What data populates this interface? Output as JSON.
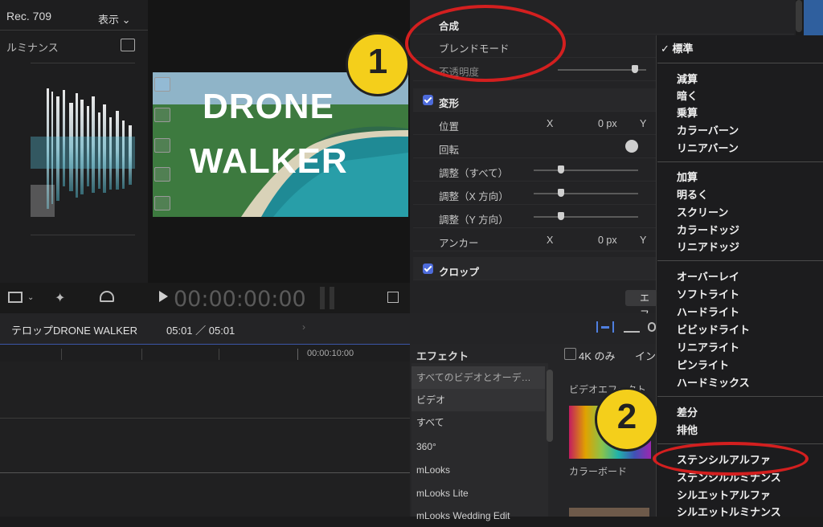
{
  "scope": {
    "colorspace": "Rec. 709",
    "view_menu": "表示 ⌄",
    "mode": "ルミナンス"
  },
  "viewer": {
    "title_line1": "DRONE",
    "title_line2": "WALKER",
    "timecode": "00:00:00:00"
  },
  "inspector": {
    "compositing": "合成",
    "blend_mode": "ブレンドモード",
    "opacity": "不透明度",
    "transform": "変形",
    "position": "位置",
    "rotation": "回転",
    "scale_all": "調整（すべて）",
    "scale_x": "調整（X 方向）",
    "scale_y": "調整（Y 方向）",
    "anchor": "アンカー",
    "crop": "クロップ",
    "x_label": "X",
    "y_label": "Y",
    "pos_x_value": "0 px",
    "anchor_x_value": "0 px",
    "effects_button": "エフ"
  },
  "timeline": {
    "project_name": "テロップDRONE WALKER",
    "duration": "05:01 ／ 05:01",
    "ruler_time": "00:00:10:00"
  },
  "effects": {
    "title": "エフェクト",
    "filter_4k": "4K のみ",
    "filter_suffix": "イン",
    "categories": [
      "すべてのビデオとオーデ…",
      "ビデオ",
      "すべて",
      "360°",
      "mLooks",
      "mLooks Lite",
      "mLooks Wedding Edit"
    ],
    "group_label": "ビデオエフェクト",
    "swatch_label": "カラーボード"
  },
  "blend_menu": {
    "selected": "✓ 標準",
    "group1": [
      "減算",
      "暗く",
      "乗算",
      "カラーバーン",
      "リニアバーン"
    ],
    "group2": [
      "加算",
      "明るく",
      "スクリーン",
      "カラードッジ",
      "リニアドッジ"
    ],
    "group3": [
      "オーバーレイ",
      "ソフトライト",
      "ハードライト",
      "ビビッドライト",
      "リニアライト",
      "ピンライト",
      "ハードミックス"
    ],
    "group4": [
      "差分",
      "排他"
    ],
    "group5": [
      "ステンシルアルファ",
      "ステンシルルミナンス",
      "シルエットアルファ",
      "シルエットルミナンス"
    ]
  },
  "annotations": {
    "marker1": "1",
    "marker2": "2",
    "marker_color": "#f4cf1b",
    "ring_color": "#d31f1f"
  }
}
